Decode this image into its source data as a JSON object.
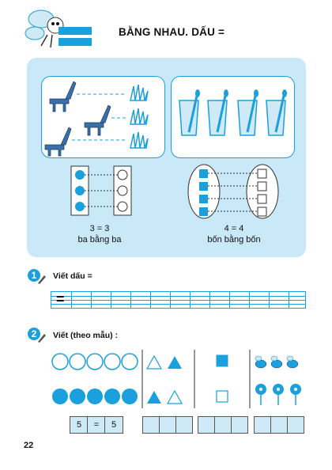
{
  "header": {
    "title": "BẰNG NHAU. DẤU ="
  },
  "lesson": {
    "left_caption_eq": "3 = 3",
    "left_caption_words": "ba bằng ba",
    "right_caption_eq": "4 = 4",
    "right_caption_words": "bốn bằng bốn"
  },
  "exercise1": {
    "number": "1",
    "label": "Viết dấu =",
    "sample_sign": "="
  },
  "exercise2": {
    "number": "2",
    "label": "Viết (theo mẫu) :",
    "example": {
      "left": "5",
      "sign": "=",
      "right": "5"
    }
  },
  "page_number": "22",
  "colors": {
    "accent": "#1aa0dc",
    "panel": "#c9e8f8",
    "fill": "#1aa0dc"
  }
}
